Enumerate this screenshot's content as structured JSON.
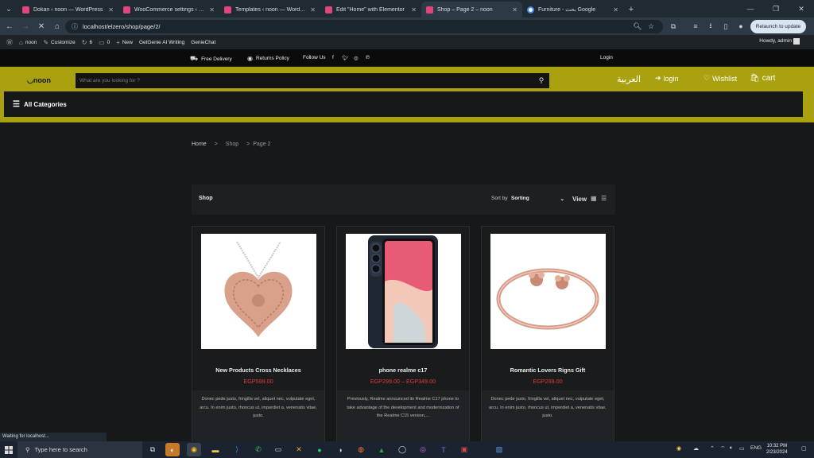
{
  "browser": {
    "tabs": [
      {
        "title": "Dokan ‹ noon — WordPress",
        "color": "#e0457b"
      },
      {
        "title": "WooCommerce settings ‹ noon",
        "color": "#e0457b"
      },
      {
        "title": "Templates ‹ noon — WordPress",
        "color": "#e0457b"
      },
      {
        "title": "Edit \"Home\" with Elementor",
        "color": "#e0457b"
      },
      {
        "title": "Shop – Page 2 – noon",
        "color": "#e0457b"
      },
      {
        "title": "Furniture - بحث Google",
        "color": "#4285f4"
      }
    ],
    "active_tab_index": 4,
    "url": "localhost/elzero/shop/page/2/",
    "relaunch_label": "Relaunch to update",
    "status_text": "Waiting for localhost..."
  },
  "admin_bar": {
    "site": "noon",
    "customize": "Customize",
    "updates": "6",
    "comments": "0",
    "new": "New",
    "plugin1": "GetGenie AI Writing",
    "plugin2": "GenieChat",
    "howdy": "Howdy, admin"
  },
  "info_bar": {
    "free_delivery": "Free Delivery",
    "returns_policy": "Returns Policy",
    "follow_us": "Follow Us",
    "login": "Login"
  },
  "header": {
    "logo": "noon",
    "search_placeholder": "What are you looking for ?",
    "arabic": "العربية",
    "login": "login",
    "wishlist": "Wishlist",
    "cart": "cart",
    "all_categories": "All Categories"
  },
  "breadcrumb": {
    "home": "Home",
    "sep": ">",
    "shop": "Shop",
    "page": "Page 2"
  },
  "shop": {
    "title": "Shop",
    "sort_label": "Sort by",
    "sort_value": "Sorting",
    "view_label": "View"
  },
  "products": [
    {
      "name": "New Products Cross Necklaces",
      "price": "EGP599.00",
      "description": "Donec pede justo, fringilla vel, aliquet nec, vulputate eget, arcu. In enim justo, rhoncus ut, imperdiet a, venenatis vitae, justo."
    },
    {
      "name": "phone realme c17",
      "price": "EGP299.00 – EGP349.00",
      "description": "Previously, Realme announced its Realme C17 phone to take advantage of the development and modernization of the Realme C15 version,..."
    },
    {
      "name": "Romantic Lovers Rigns Gift",
      "price": "EGP299.00",
      "description": "Donec pede justo, fringilla vel, aliquet nec, vulputate eget, arcu. In enim justo, rhoncus ut, imperdiet a, venenatis vitae, justo."
    }
  ],
  "taskbar": {
    "search_placeholder": "Type here to search",
    "language": "ENG",
    "time": "10:32 PM",
    "date": "2/23/2024"
  },
  "colors": {
    "header_yellow": "#a9a10f",
    "price_red": "#e23b3b"
  }
}
